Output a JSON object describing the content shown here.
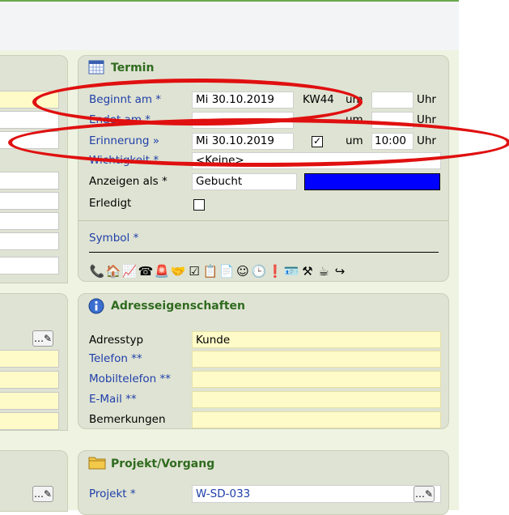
{
  "termin": {
    "title": "Termin",
    "beginnt_label": "Beginnt am *",
    "beginnt_value": "Mi 30.10.2019",
    "kw": "KW44",
    "um_label": "um",
    "uhr_label": "Uhr",
    "endet_label": "Endet am *",
    "endet_value": "",
    "erinnerung_label": "Erinnerung »",
    "erinnerung_value": "Mi 30.10.2019",
    "erinnerung_checked": "✓",
    "erinnerung_time": "10:00",
    "wichtigkeit_label": "Wichtigkeit *",
    "wichtigkeit_value": "<Keine>",
    "anzeigen_label": "Anzeigen als *",
    "anzeigen_value": "Gebucht",
    "anzeigen_color": "#0000ff",
    "erledigt_label": "Erledigt",
    "symbol_label": "Symbol *",
    "symbols": [
      "phone-in-icon",
      "house-icon",
      "pulse-chart-icon",
      "telephone-icon",
      "alarm-light-icon",
      "handshake-icon",
      "checkbox-list-icon",
      "warning-list-icon",
      "document-icon",
      "smiley-icon",
      "clock-icon",
      "exclamation-icon",
      "id-card-icon",
      "tools-icon",
      "coffee-icon",
      "redo-arrow-icon"
    ]
  },
  "adresse": {
    "title": "Adresseigenschaften",
    "adresstyp_label": "Adresstyp",
    "adresstyp_value": "Kunde",
    "telefon_label": "Telefon **",
    "mobil_label": "Mobiltelefon **",
    "email_label": "E-Mail **",
    "bemerkungen_label": "Bemerkungen"
  },
  "projekt": {
    "title": "Projekt/Vorgang",
    "projekt_label": "Projekt *",
    "projekt_value": "W-SD-033"
  },
  "colors": {
    "panel_bg": "#dfe3d3",
    "title_green": "#2f6b1f",
    "label_blue": "#1f3faa",
    "highlight_red": "#e01010",
    "yellow_field": "#fffbc8"
  }
}
